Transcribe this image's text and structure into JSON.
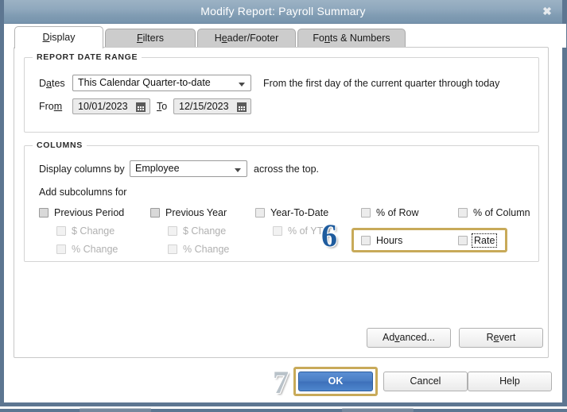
{
  "window": {
    "title": "Modify Report: Payroll Summary",
    "close_icon": "close-icon",
    "close_glyph": "✖"
  },
  "tabs": [
    {
      "label": "Display",
      "accel": "D",
      "active": true
    },
    {
      "label": "Filters",
      "accel": "F",
      "active": false
    },
    {
      "label": "Header/Footer",
      "accel": "H",
      "active": false
    },
    {
      "label": "Fonts & Numbers",
      "accel": "N",
      "active": false
    }
  ],
  "date_range": {
    "legend": "REPORT DATE RANGE",
    "dates_label": "Dates",
    "dates_accel": "a",
    "dates_value": "This Calendar Quarter-to-date",
    "hint": "From the first day of the current quarter through today",
    "from_label": "From",
    "from_accel": "m",
    "from_value": "10/01/2023",
    "to_label": "To",
    "to_accel": "T",
    "to_value": "12/15/2023",
    "calendar_icon": "calendar-icon"
  },
  "columns": {
    "legend": "COLUMNS",
    "display_by_label": "Display columns by",
    "display_by_value": "Employee",
    "across_label": "across the top.",
    "subcolumns_label": "Add subcolumns for",
    "checkboxes": {
      "previous_period": {
        "label": "Previous Period",
        "checked": false,
        "enabled": true
      },
      "pp_dollar_change": {
        "label": "$ Change",
        "checked": false,
        "enabled": false
      },
      "pp_percent_change": {
        "label": "% Change",
        "checked": false,
        "enabled": false
      },
      "previous_year": {
        "label": "Previous Year",
        "checked": false,
        "enabled": true
      },
      "py_dollar_change": {
        "label": "$ Change",
        "checked": false,
        "enabled": false
      },
      "py_percent_change": {
        "label": "% Change",
        "checked": false,
        "enabled": false
      },
      "year_to_date": {
        "label": "Year-To-Date",
        "checked": false,
        "enabled": true
      },
      "percent_of_ytd": {
        "label": "% of YTD",
        "checked": false,
        "enabled": false
      },
      "percent_of_row": {
        "label": "% of Row",
        "checked": false,
        "enabled": true
      },
      "percent_of_column": {
        "label": "% of Column",
        "checked": false,
        "enabled": true
      },
      "hours": {
        "label": "Hours",
        "checked": false,
        "enabled": true
      },
      "rate": {
        "label": "Rate",
        "checked": false,
        "enabled": true,
        "focused": true
      }
    }
  },
  "secondary_buttons": {
    "advanced": {
      "label": "Advanced...",
      "accel": "v"
    },
    "revert": {
      "label": "Revert",
      "accel": "e"
    }
  },
  "footer_buttons": {
    "ok": {
      "label": "OK",
      "primary": true
    },
    "cancel": {
      "label": "Cancel"
    },
    "help": {
      "label": "Help"
    }
  },
  "callouts": [
    {
      "number": "6",
      "style": "blue",
      "target": "hours-rate-group"
    },
    {
      "number": "7",
      "style": "silver",
      "target": "ok-button"
    }
  ],
  "colors": {
    "titlebar_from": "#9cb2c4",
    "titlebar_to": "#7794ad",
    "window_frame": "#5d7691",
    "highlight_gold": "#c8aa59",
    "primary_button": "#4a7ec4",
    "callout_blue": "#1f5c9e",
    "callout_silver": "#b9c2c9"
  }
}
